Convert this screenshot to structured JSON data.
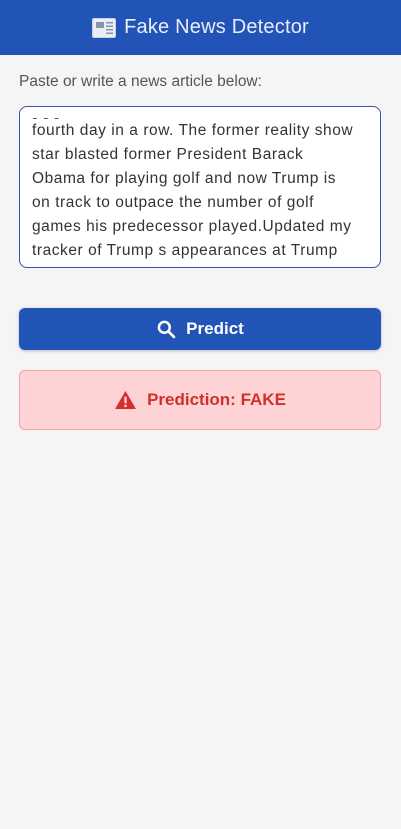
{
  "app_bar": {
    "icon": "newspaper-icon",
    "title": "Fake News Detector",
    "color": "#2254b8"
  },
  "form": {
    "prompt_label": "Paste or write a news article below:",
    "article_visible_lines": [
      "fourth day in a row. The former reality show",
      "star blasted former President Barack",
      "Obama for playing golf and now Trump is",
      "on track to outpace the number of golf",
      "games his predecessor played.Updated my",
      "tracker of Trump s appearances at Trump"
    ]
  },
  "predict_button": {
    "icon": "search-icon",
    "label": "Predict"
  },
  "result": {
    "icon": "warning-icon",
    "text": "Prediction: FAKE",
    "status_color": "#d32f2f"
  }
}
